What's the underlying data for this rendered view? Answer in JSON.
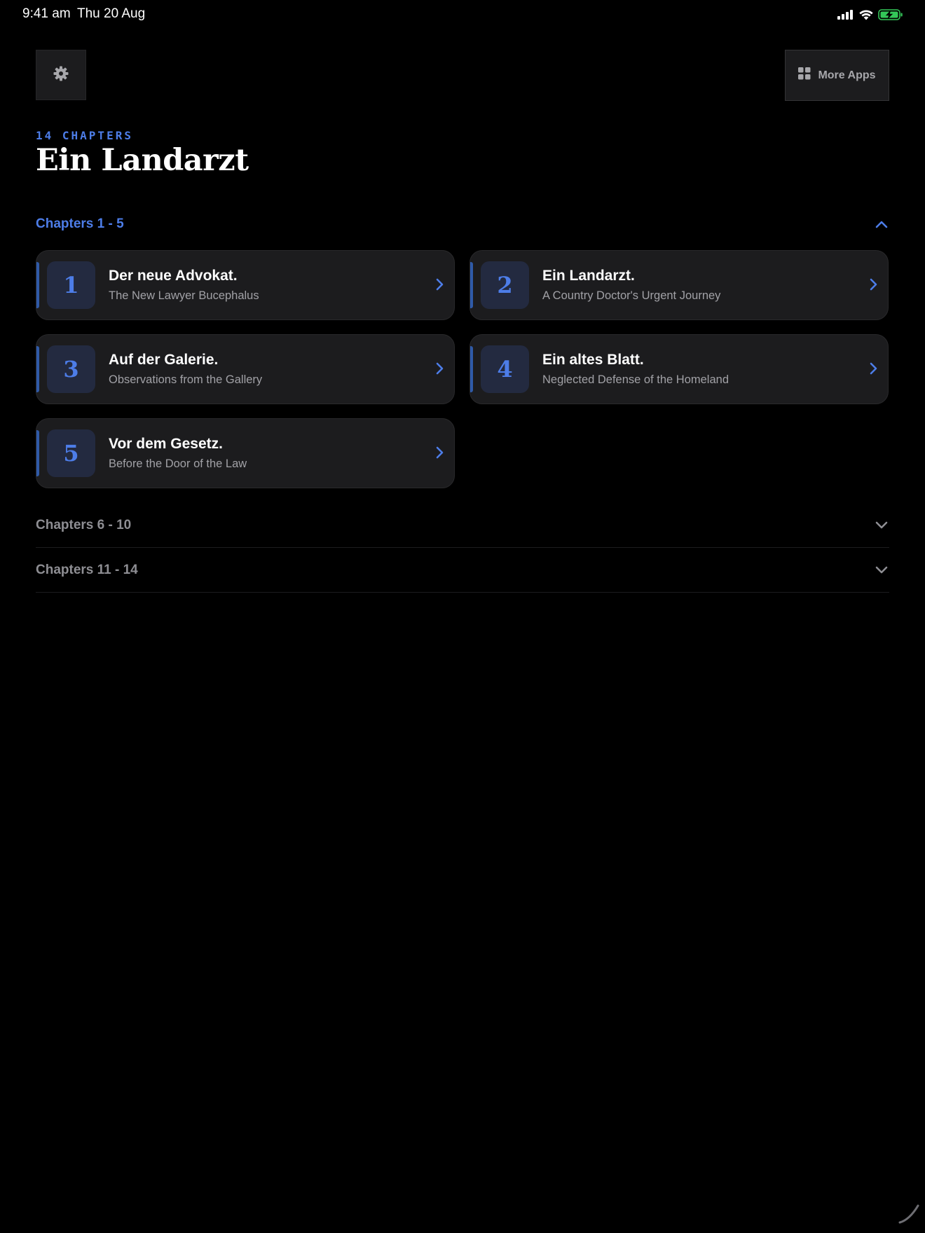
{
  "status_bar": {
    "time": "9:41 am",
    "date": "Thu 20 Aug",
    "battery_color": "#34c759"
  },
  "toolbar": {
    "settings_icon": "gear-icon",
    "more_apps_label": "More Apps",
    "more_apps_icon": "grid-icon"
  },
  "header": {
    "chapter_count": "14 CHAPTERS",
    "title": "Ein Landarzt"
  },
  "colors": {
    "accent": "#4d7de8",
    "background": "#000000",
    "card": "#1c1c1e"
  },
  "sections": [
    {
      "label": "Chapters 1 - 5",
      "expanded": true,
      "chapters": [
        {
          "number": "1",
          "title": "Der neue Advokat.",
          "subtitle": "The New Lawyer Bucephalus"
        },
        {
          "number": "2",
          "title": "Ein Landarzt.",
          "subtitle": "A Country Doctor's Urgent Journey"
        },
        {
          "number": "3",
          "title": "Auf der Galerie.",
          "subtitle": "Observations from the Gallery"
        },
        {
          "number": "4",
          "title": "Ein altes Blatt.",
          "subtitle": "Neglected Defense of the Homeland"
        },
        {
          "number": "5",
          "title": "Vor dem Gesetz.",
          "subtitle": "Before the Door of the Law"
        }
      ]
    },
    {
      "label": "Chapters 6 - 10",
      "expanded": false
    },
    {
      "label": "Chapters 11 - 14",
      "expanded": false
    }
  ]
}
